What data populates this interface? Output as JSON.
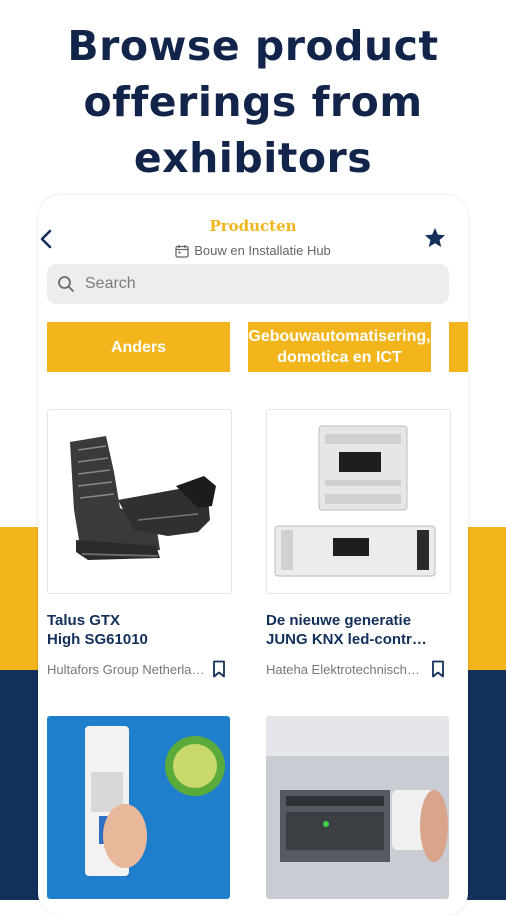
{
  "headline": {
    "line1": "Browse product",
    "line2": "offerings from",
    "line3": "exhibitors"
  },
  "header": {
    "title": "Producten",
    "event_name": "Bouw en Installatie Hub"
  },
  "search": {
    "placeholder": "Search"
  },
  "categories": [
    {
      "label": "Anders"
    },
    {
      "label": "Gebouwautomatisering, domotica en ICT"
    }
  ],
  "products": [
    {
      "title": "Talus GTX\nHigh SG61010",
      "exhibitor": "Hultafors Group Netherlands"
    },
    {
      "title": "De nieuwe generatie\nJUNG KNX led-contr…",
      "exhibitor": "Hateha Elektrotechnische Handelsonderneming"
    },
    {
      "title": "",
      "exhibitor": ""
    },
    {
      "title": "",
      "exhibitor": ""
    }
  ],
  "colors": {
    "brand_yellow": "#f2b51c",
    "brand_navy": "#13305b",
    "headline_navy": "#13244a"
  }
}
